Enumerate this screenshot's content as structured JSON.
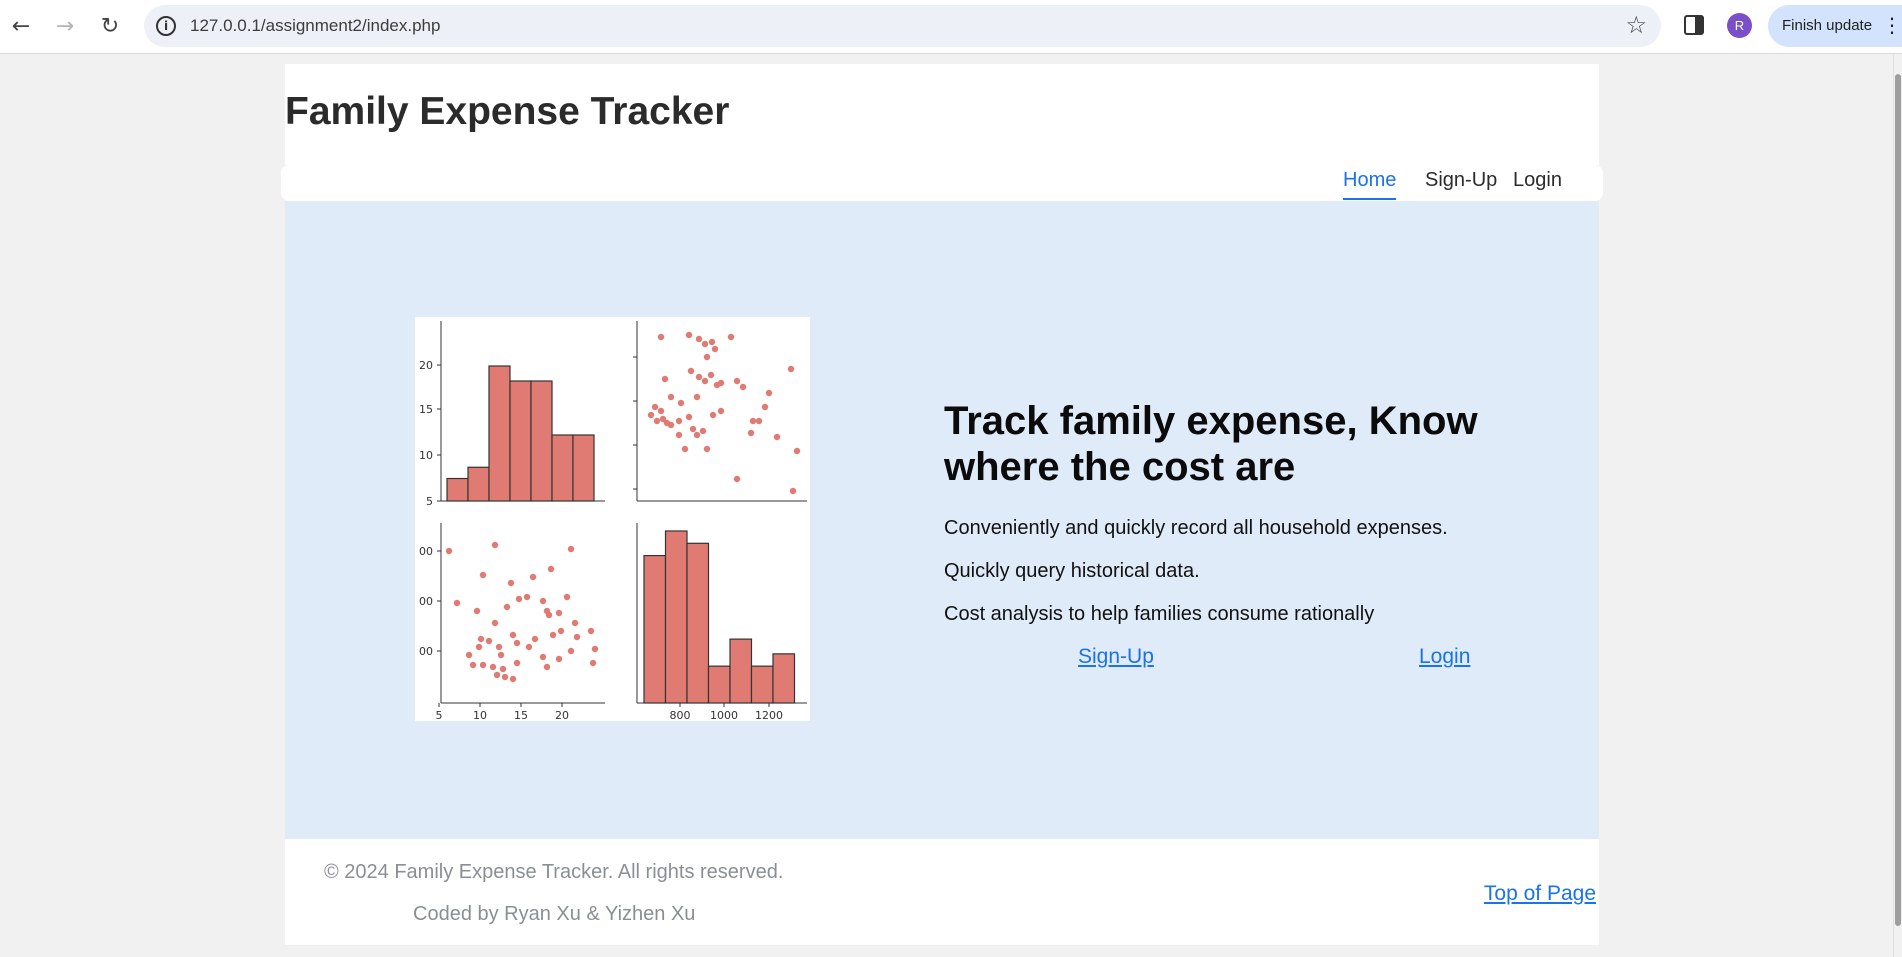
{
  "browser": {
    "url": "127.0.0.1/assignment2/index.php",
    "update_button": "Finish update",
    "avatar_letter": "R",
    "avatar_color": "#7b4fc9"
  },
  "site": {
    "title": "Family Expense Tracker",
    "nav": [
      {
        "label": "Home",
        "active": true
      },
      {
        "label": "Sign-Up",
        "active": false
      },
      {
        "label": "Login",
        "active": false
      }
    ]
  },
  "hero": {
    "headline": "Track family expense, Know where the cost are",
    "lines": [
      "Conveniently and quickly record all household expenses.",
      "Quickly query historical data.",
      "Cost analysis to help families consume rationally"
    ],
    "signup_label": "Sign-Up",
    "login_label": "Login",
    "bg_color": "#e0ebf9"
  },
  "chart_data": {
    "type": "scatter",
    "description_kind": "pairplot",
    "color": "#e07b73",
    "panels": [
      {
        "position": "top-left",
        "type": "bar",
        "bins": [
          5,
          7.5,
          10,
          12.5,
          15,
          17.5,
          20,
          22.5
        ],
        "values": [
          3,
          4.5,
          18,
          16,
          16,
          8.8,
          8.8
        ],
        "ytick_labels": [
          "5",
          "10",
          "15",
          "20"
        ]
      },
      {
        "position": "top-right",
        "type": "scatter"
      },
      {
        "position": "bottom-left",
        "type": "scatter",
        "ytick_labels": [
          "00",
          "00",
          "00"
        ],
        "xtick_labels": [
          "5",
          "10",
          "15",
          "20"
        ]
      },
      {
        "position": "bottom-right",
        "type": "bar",
        "bins": [
          650,
          750,
          850,
          950,
          1050,
          1150,
          1250
        ],
        "values": [
          12,
          14,
          13,
          3,
          5.2,
          3,
          4
        ],
        "xtick_labels": [
          "800",
          "1000",
          "1200"
        ]
      }
    ]
  },
  "footer": {
    "copyright": "© 2024 Family Expense Tracker. All rights reserved.",
    "coded_by": "Coded by Ryan Xu & Yizhen Xu",
    "top_link": "Top of Page"
  }
}
